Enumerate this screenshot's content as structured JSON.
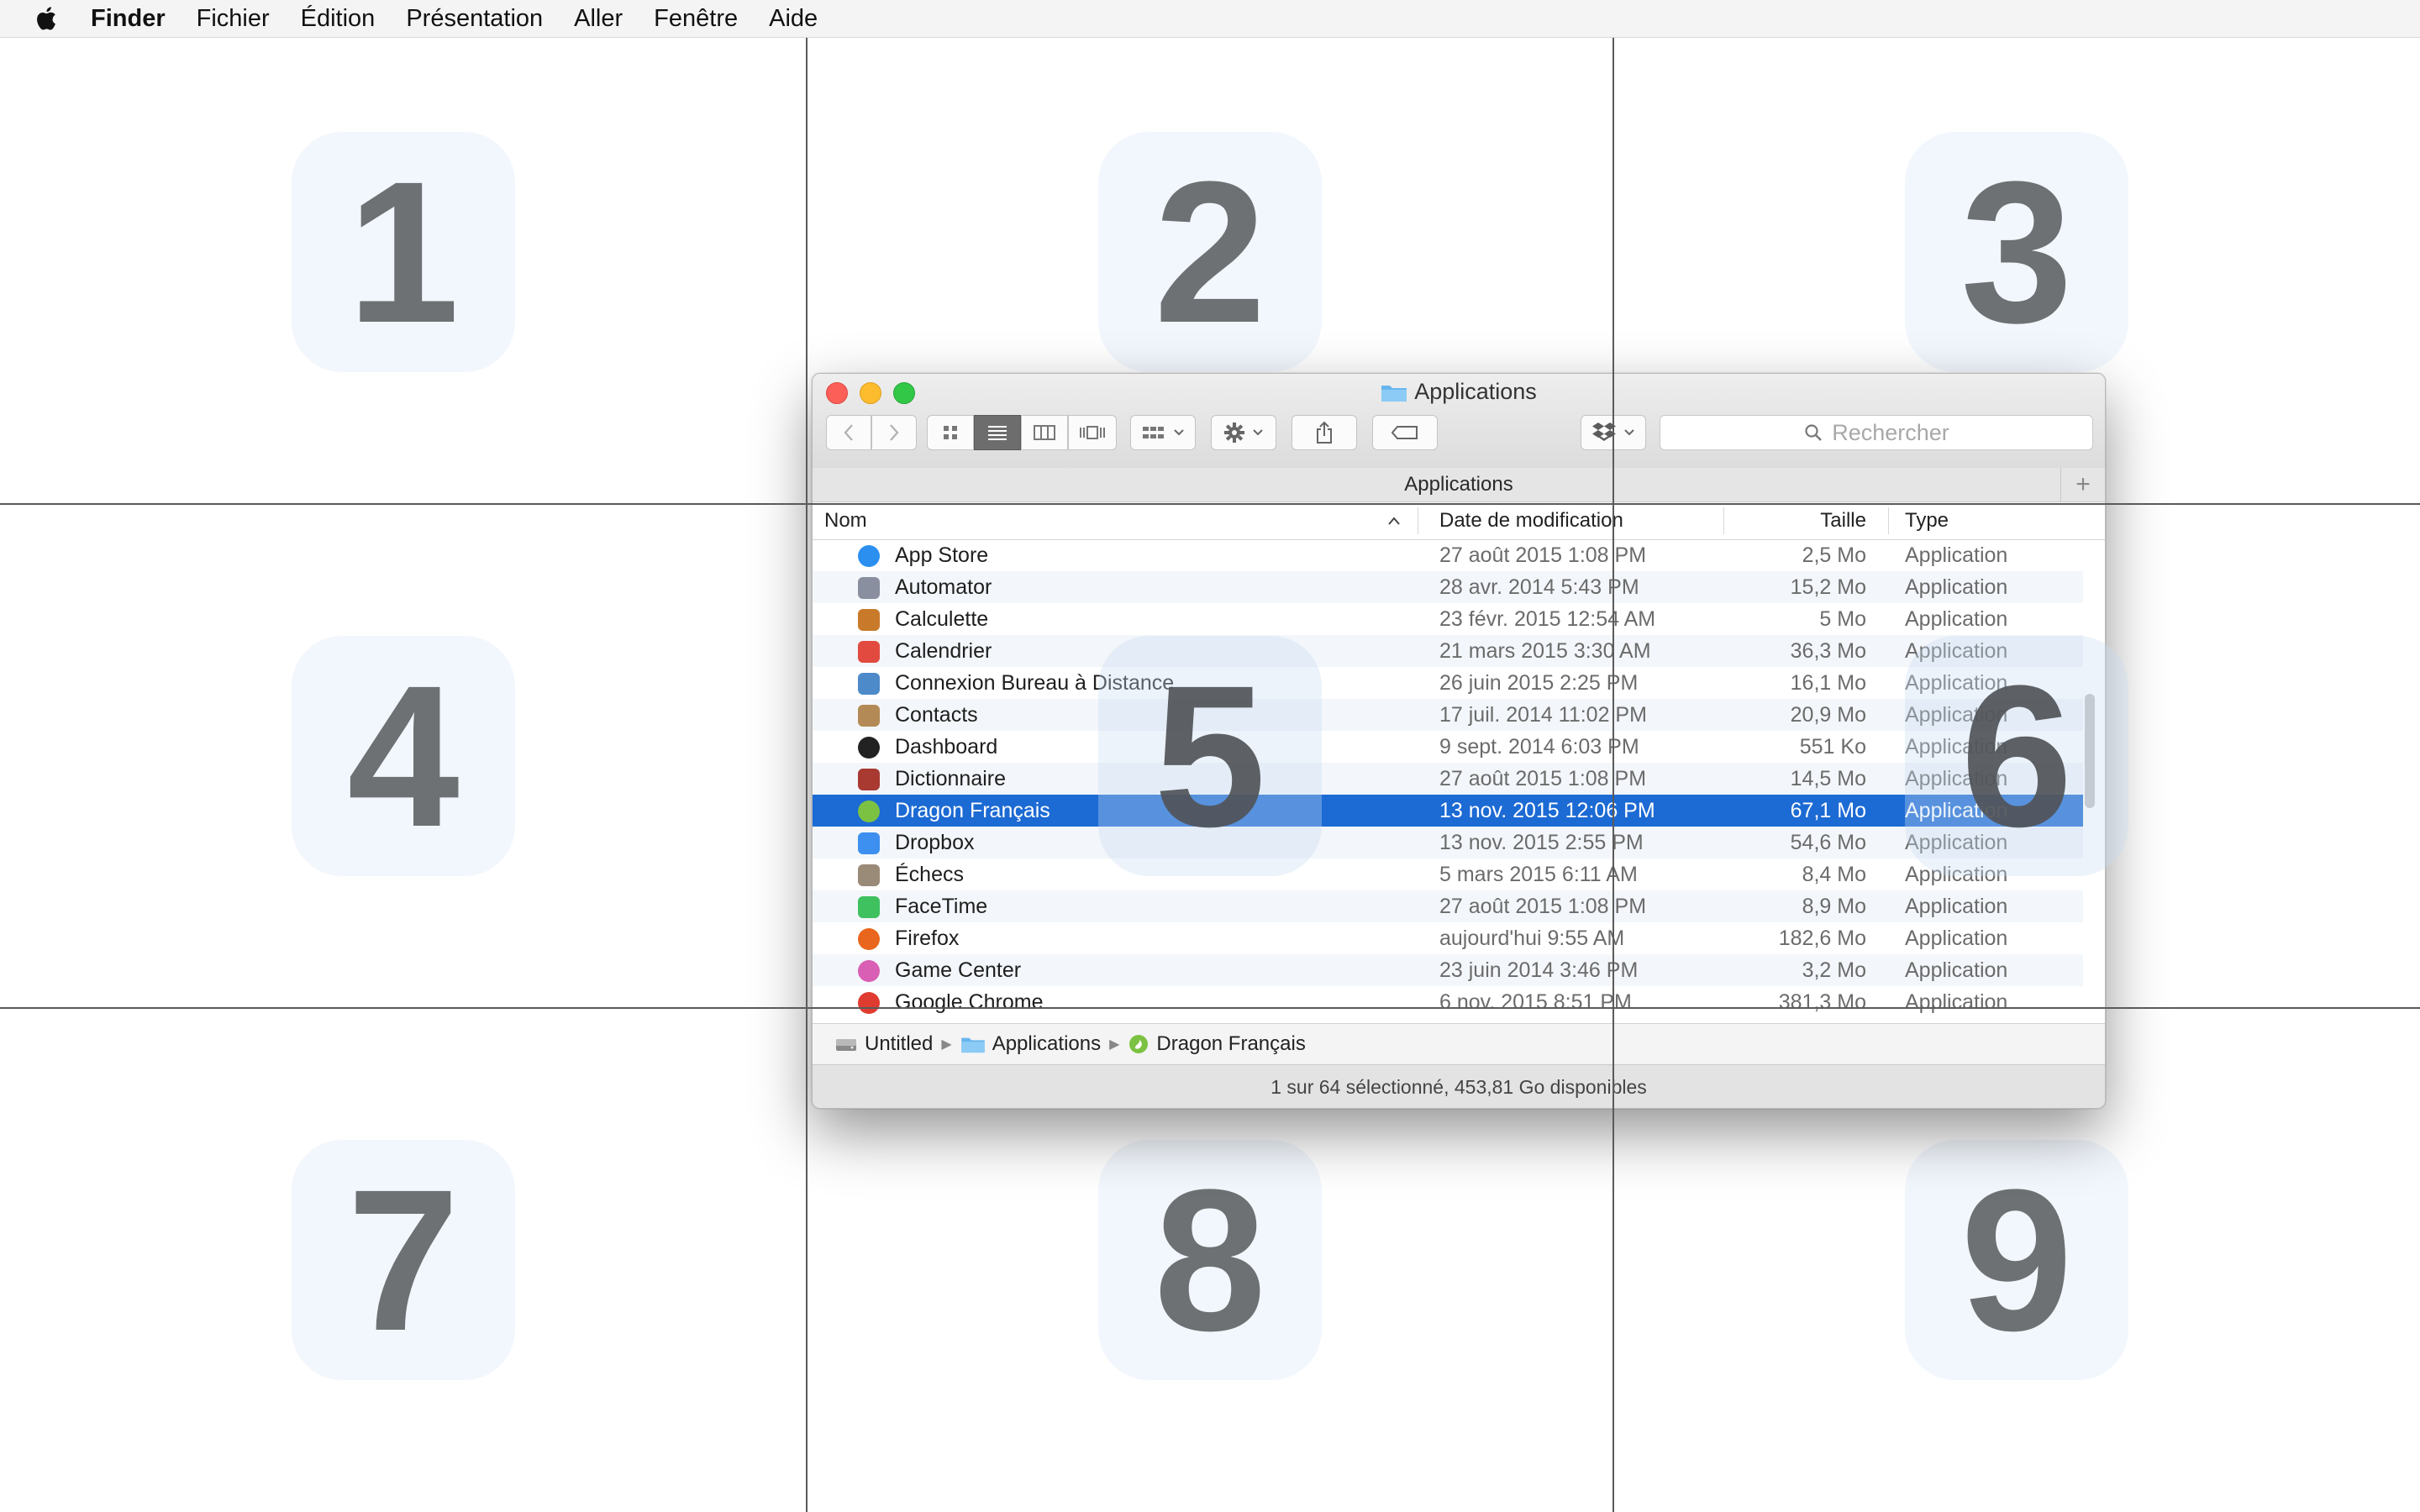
{
  "menubar": {
    "app": "Finder",
    "items": [
      "Fichier",
      "Édition",
      "Présentation",
      "Aller",
      "Fenêtre",
      "Aide"
    ]
  },
  "zones": [
    "1",
    "2",
    "3",
    "4",
    "5",
    "6",
    "7",
    "8",
    "9"
  ],
  "window": {
    "title": "Applications",
    "path_title": "Applications",
    "search_placeholder": "Rechercher",
    "columns": {
      "name": "Nom",
      "date": "Date de modification",
      "size": "Taille",
      "type": "Type"
    },
    "rows": [
      {
        "name": "App Store",
        "date": "27 août 2015 1:08 PM",
        "size": "2,5 Mo",
        "type": "Application",
        "icon": "app-store-icon",
        "color": "#2b8ff0"
      },
      {
        "name": "Automator",
        "date": "28 avr. 2014 5:43 PM",
        "size": "15,2 Mo",
        "type": "Application",
        "icon": "automator-icon",
        "color": "#8a8fa0"
      },
      {
        "name": "Calculette",
        "date": "23 févr. 2015 12:54 AM",
        "size": "5 Mo",
        "type": "Application",
        "icon": "calculator-icon",
        "color": "#c87a2a"
      },
      {
        "name": "Calendrier",
        "date": "21 mars 2015 3:30 AM",
        "size": "36,3 Mo",
        "type": "Application",
        "icon": "calendar-icon",
        "color": "#e24a3f"
      },
      {
        "name": "Connexion Bureau à Distance",
        "date": "26 juin 2015 2:25 PM",
        "size": "16,1 Mo",
        "type": "Application",
        "icon": "remote-desktop-icon",
        "color": "#4d8ac9"
      },
      {
        "name": "Contacts",
        "date": "17 juil. 2014 11:02 PM",
        "size": "20,9 Mo",
        "type": "Application",
        "icon": "contacts-icon",
        "color": "#b38a55"
      },
      {
        "name": "Dashboard",
        "date": "9 sept. 2014 6:03 PM",
        "size": "551 Ko",
        "type": "Application",
        "icon": "dashboard-icon",
        "color": "#222222"
      },
      {
        "name": "Dictionnaire",
        "date": "27 août 2015 1:08 PM",
        "size": "14,5 Mo",
        "type": "Application",
        "icon": "dictionary-icon",
        "color": "#a83a32"
      },
      {
        "name": "Dragon Français",
        "date": "13 nov. 2015 12:06 PM",
        "size": "67,1 Mo",
        "type": "Application",
        "icon": "dragon-icon",
        "color": "#7cc242",
        "selected": true
      },
      {
        "name": "Dropbox",
        "date": "13 nov. 2015 2:55 PM",
        "size": "54,6 Mo",
        "type": "Application",
        "icon": "dropbox-icon",
        "color": "#3d8ff0"
      },
      {
        "name": "Échecs",
        "date": "5 mars 2015 6:11 AM",
        "size": "8,4 Mo",
        "type": "Application",
        "icon": "chess-icon",
        "color": "#9a8a78"
      },
      {
        "name": "FaceTime",
        "date": "27 août 2015 1:08 PM",
        "size": "8,9 Mo",
        "type": "Application",
        "icon": "facetime-icon",
        "color": "#3fc160"
      },
      {
        "name": "Firefox",
        "date": "aujourd'hui 9:55 AM",
        "size": "182,6 Mo",
        "type": "Application",
        "icon": "firefox-icon",
        "color": "#e8661d"
      },
      {
        "name": "Game Center",
        "date": "23 juin 2014 3:46 PM",
        "size": "3,2 Mo",
        "type": "Application",
        "icon": "game-center-icon",
        "color": "#d95fb4"
      },
      {
        "name": "Google Chrome",
        "date": "6 nov. 2015 8:51 PM",
        "size": "381,3 Mo",
        "type": "Application",
        "icon": "chrome-icon",
        "color": "#df3b30"
      }
    ],
    "breadcrumb": [
      "Untitled",
      "Applications",
      "Dragon Français"
    ],
    "status": "1 sur 64 sélectionné, 453,81 Go disponibles"
  }
}
